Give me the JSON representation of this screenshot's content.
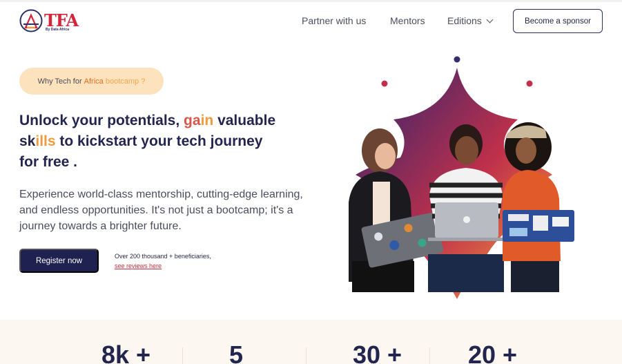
{
  "brand": {
    "logo_text": "TFA",
    "logo_subtext": "By Data Africa",
    "primary": "#1f2150",
    "accent_red": "#d3263a",
    "accent_orange": "#f09a3e",
    "pill_bg": "#fde3bd",
    "stats_bg": "#fdf7f1"
  },
  "nav": {
    "partner": "Partner with us",
    "mentors": "Mentors",
    "editions": "Editions",
    "sponsor_button": "Become a sponsor"
  },
  "hero": {
    "pill_prefix": "Why Tech for",
    "pill_accent": "Africa",
    "pill_suffix": "bootcamp ?",
    "headline_1": "Unlock your potentials,",
    "headline_g1": "ga",
    "headline_g2": "in",
    "headline_2": "valuable",
    "headline_3": "sk",
    "headline_g3": "ills",
    "headline_4": "to kickstart your tech journey",
    "headline_5": "for free .",
    "lead": "Experience world-class mentorship, cutting-edge learning, and endless opportunities. It's not just a bootcamp; it's a journey towards a brighter future.",
    "register_button": "Register now",
    "beneficiaries": "Over 200 thousand + beneficiaries,",
    "reviews_link": "see reviews here"
  },
  "stats": [
    "8k +",
    "5",
    "30 +",
    "20 +"
  ],
  "icons": {
    "logo": "triangle-logo-icon",
    "editions_chevron": "chevron-down-icon",
    "laptop_logo": "apple-icon"
  }
}
